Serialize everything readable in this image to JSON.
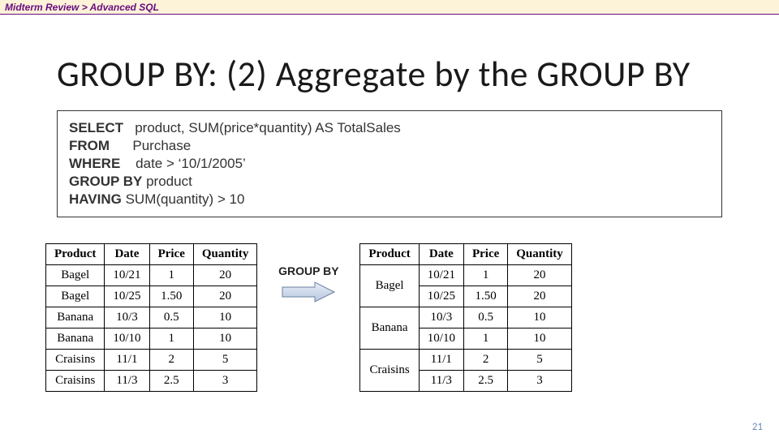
{
  "breadcrumb": "Midterm Review  >  Advanced SQL",
  "title": "GROUP BY: (2) Aggregate by the GROUP BY",
  "sql": {
    "line1_kw": "SELECT",
    "line1_rest": "   product, SUM(price*quantity) AS TotalSales",
    "line2_kw": "FROM",
    "line2_rest": "      Purchase",
    "line3_kw": "WHERE",
    "line3_rest": "    date > ‘10/1/2005’",
    "line4_kw": "GROUP BY",
    "line4_rest": " product",
    "line5_kw": "HAVING",
    "line5_rest": " SUM(quantity) > 10"
  },
  "group_by_label": "GROUP BY",
  "table1": {
    "headers": [
      "Product",
      "Date",
      "Price",
      "Quantity"
    ],
    "rows": [
      [
        "Bagel",
        "10/21",
        "1",
        "20"
      ],
      [
        "Bagel",
        "10/25",
        "1.50",
        "20"
      ],
      [
        "Banana",
        "10/3",
        "0.5",
        "10"
      ],
      [
        "Banana",
        "10/10",
        "1",
        "10"
      ],
      [
        "Craisins",
        "11/1",
        "2",
        "5"
      ],
      [
        "Craisins",
        "11/3",
        "2.5",
        "3"
      ]
    ]
  },
  "table2": {
    "headers": [
      "Product",
      "Date",
      "Price",
      "Quantity"
    ],
    "groups": [
      {
        "product": "Bagel",
        "rows": [
          [
            "10/21",
            "1",
            "20"
          ],
          [
            "10/25",
            "1.50",
            "20"
          ]
        ]
      },
      {
        "product": "Banana",
        "rows": [
          [
            "10/3",
            "0.5",
            "10"
          ],
          [
            "10/10",
            "1",
            "10"
          ]
        ]
      },
      {
        "product": "Craisins",
        "rows": [
          [
            "11/1",
            "2",
            "5"
          ],
          [
            "11/3",
            "2.5",
            "3"
          ]
        ]
      }
    ]
  },
  "page_number": "21"
}
